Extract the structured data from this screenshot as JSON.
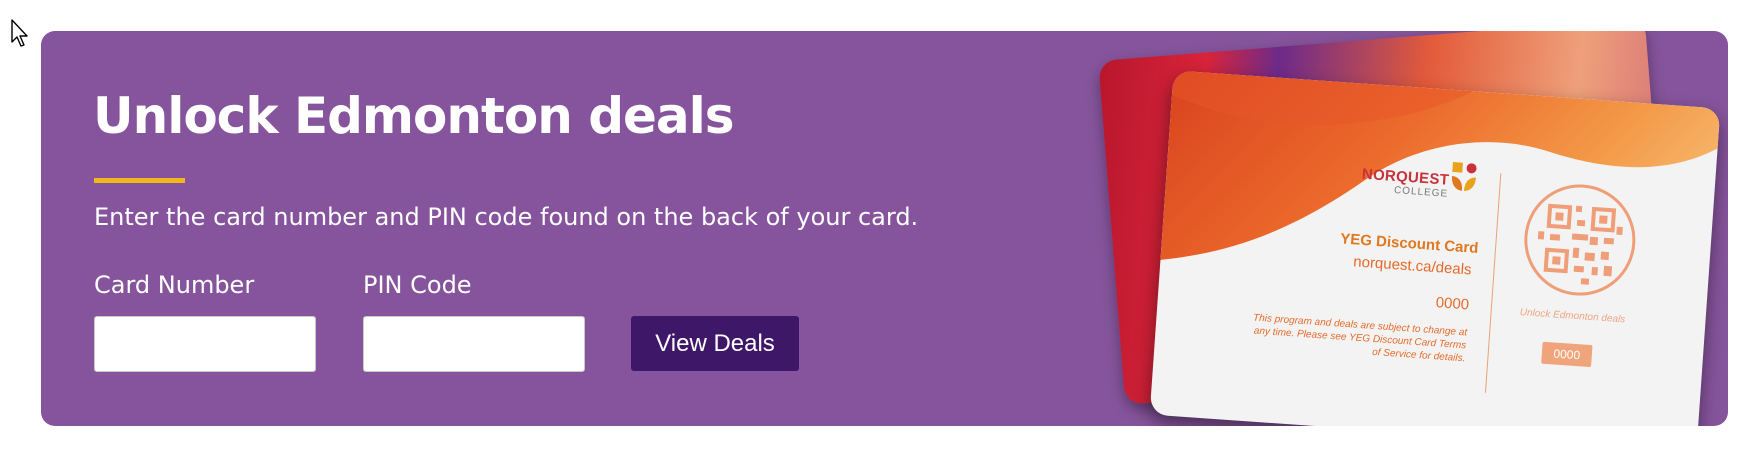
{
  "banner": {
    "title": "Unlock Edmonton deals",
    "instructions": "Enter the card number and PIN code found on the back of your card.",
    "card_number_label": "Card Number",
    "card_number_value": "",
    "pin_label": "PIN Code",
    "pin_value": "",
    "submit_label": "View Deals"
  },
  "card_image": {
    "brand_main": "NORQUEST",
    "brand_sub": "COLLEGE",
    "card_name": "YEG Discount Card",
    "url": "norquest.ca/deals",
    "number": "0000",
    "terms": "This program and deals are subject to change at any time. Please see YEG Discount Card Terms of Service for details.",
    "unlock_text": "Unlock Edmonton deals",
    "pin": "0000"
  },
  "colors": {
    "panel": "#86549c",
    "accent": "#f2b71d",
    "button": "#3f1768",
    "card_orange": "#e56a2a"
  },
  "icons": {
    "cursor": "mouse-pointer-icon",
    "qr": "qr-code-icon",
    "logo": "norquest-logo-icon"
  }
}
